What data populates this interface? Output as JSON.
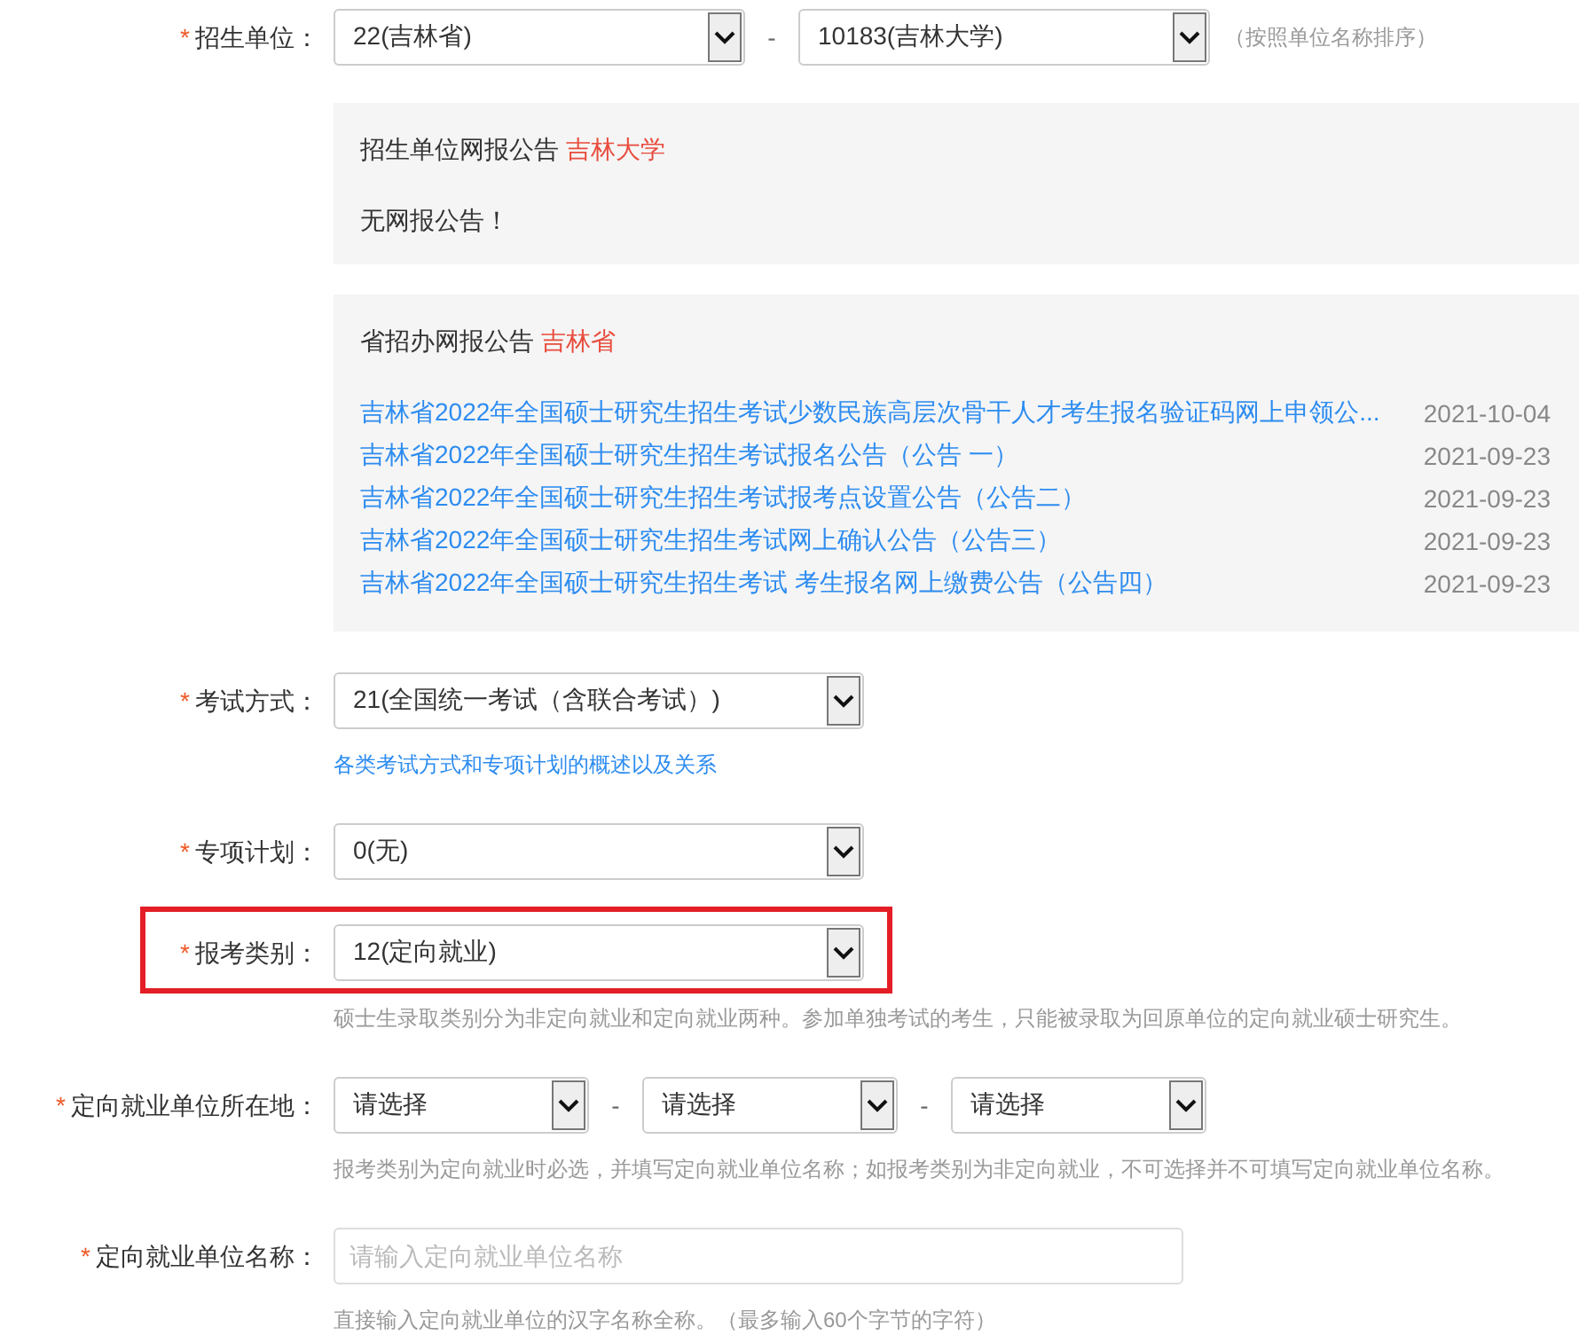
{
  "fields": [
    {
      "kind": "select",
      "label": "招生单位：",
      "required_mark": "*",
      "highlighted": false,
      "selects": [
        "22(吉林省)",
        "10183(吉林大学)"
      ],
      "separators": [
        "-"
      ],
      "note": "（按照单位名称排序）",
      "panels": [
        {
          "title": "招生单位网报公告",
          "place": "吉林大学",
          "message": "无网报公告！"
        },
        {
          "title": "省招办网报公告",
          "place": "吉林省",
          "items": [
            {
              "title": "吉林省2022年全国硕士研究生招生考试少数民族高层次骨干人才考生报名验证码网上申领公...",
              "date": "2021-10-04"
            },
            {
              "title": "吉林省2022年全国硕士研究生招生考试报名公告（公告 一）",
              "date": "2021-09-23"
            },
            {
              "title": "吉林省2022年全国硕士研究生招生考试报考点设置公告（公告二）",
              "date": "2021-09-23"
            },
            {
              "title": "吉林省2022年全国硕士研究生招生考试网上确认公告（公告三）",
              "date": "2021-09-23"
            },
            {
              "title": "吉林省2022年全国硕士研究生招生考试 考生报名网上缴费公告（公告四）",
              "date": "2021-09-23"
            }
          ]
        }
      ]
    },
    {
      "kind": "select",
      "label": "考试方式：",
      "required_mark": "*",
      "highlighted": false,
      "selects": [
        "21(全国统一考试（含联合考试）)"
      ],
      "hint": {
        "kind": "link",
        "text": "各类考试方式和专项计划的概述以及关系"
      }
    },
    {
      "kind": "select",
      "label": "专项计划：",
      "required_mark": "*",
      "highlighted": false,
      "selects": [
        "0(无)"
      ]
    },
    {
      "kind": "select",
      "label": "报考类别：",
      "required_mark": "*",
      "highlighted": true,
      "selects": [
        "12(定向就业)"
      ],
      "hint": {
        "kind": "note",
        "text": "硕士生录取类别分为非定向就业和定向就业两种。参加单独考试的考生，只能被录取为回原单位的定向就业硕士研究生。"
      }
    },
    {
      "kind": "select",
      "label": "定向就业单位所在地：",
      "required_mark": "*",
      "highlighted": false,
      "selects": [
        "请选择",
        "请选择",
        "请选择"
      ],
      "separators": [
        "-",
        "-"
      ],
      "hint": {
        "kind": "note",
        "text": "报考类别为定向就业时必选，并填写定向就业单位名称；如报考类别为非定向就业，不可选择并不可填写定向就业单位名称。"
      }
    },
    {
      "kind": "input",
      "label": "定向就业单位名称：",
      "required_mark": "*",
      "highlighted": false,
      "placeholder": "请输入定向就业单位名称",
      "hint": {
        "kind": "note",
        "text": "直接输入定向就业单位的汉字名称全称。（最多输入60个字节的字符）"
      }
    }
  ]
}
